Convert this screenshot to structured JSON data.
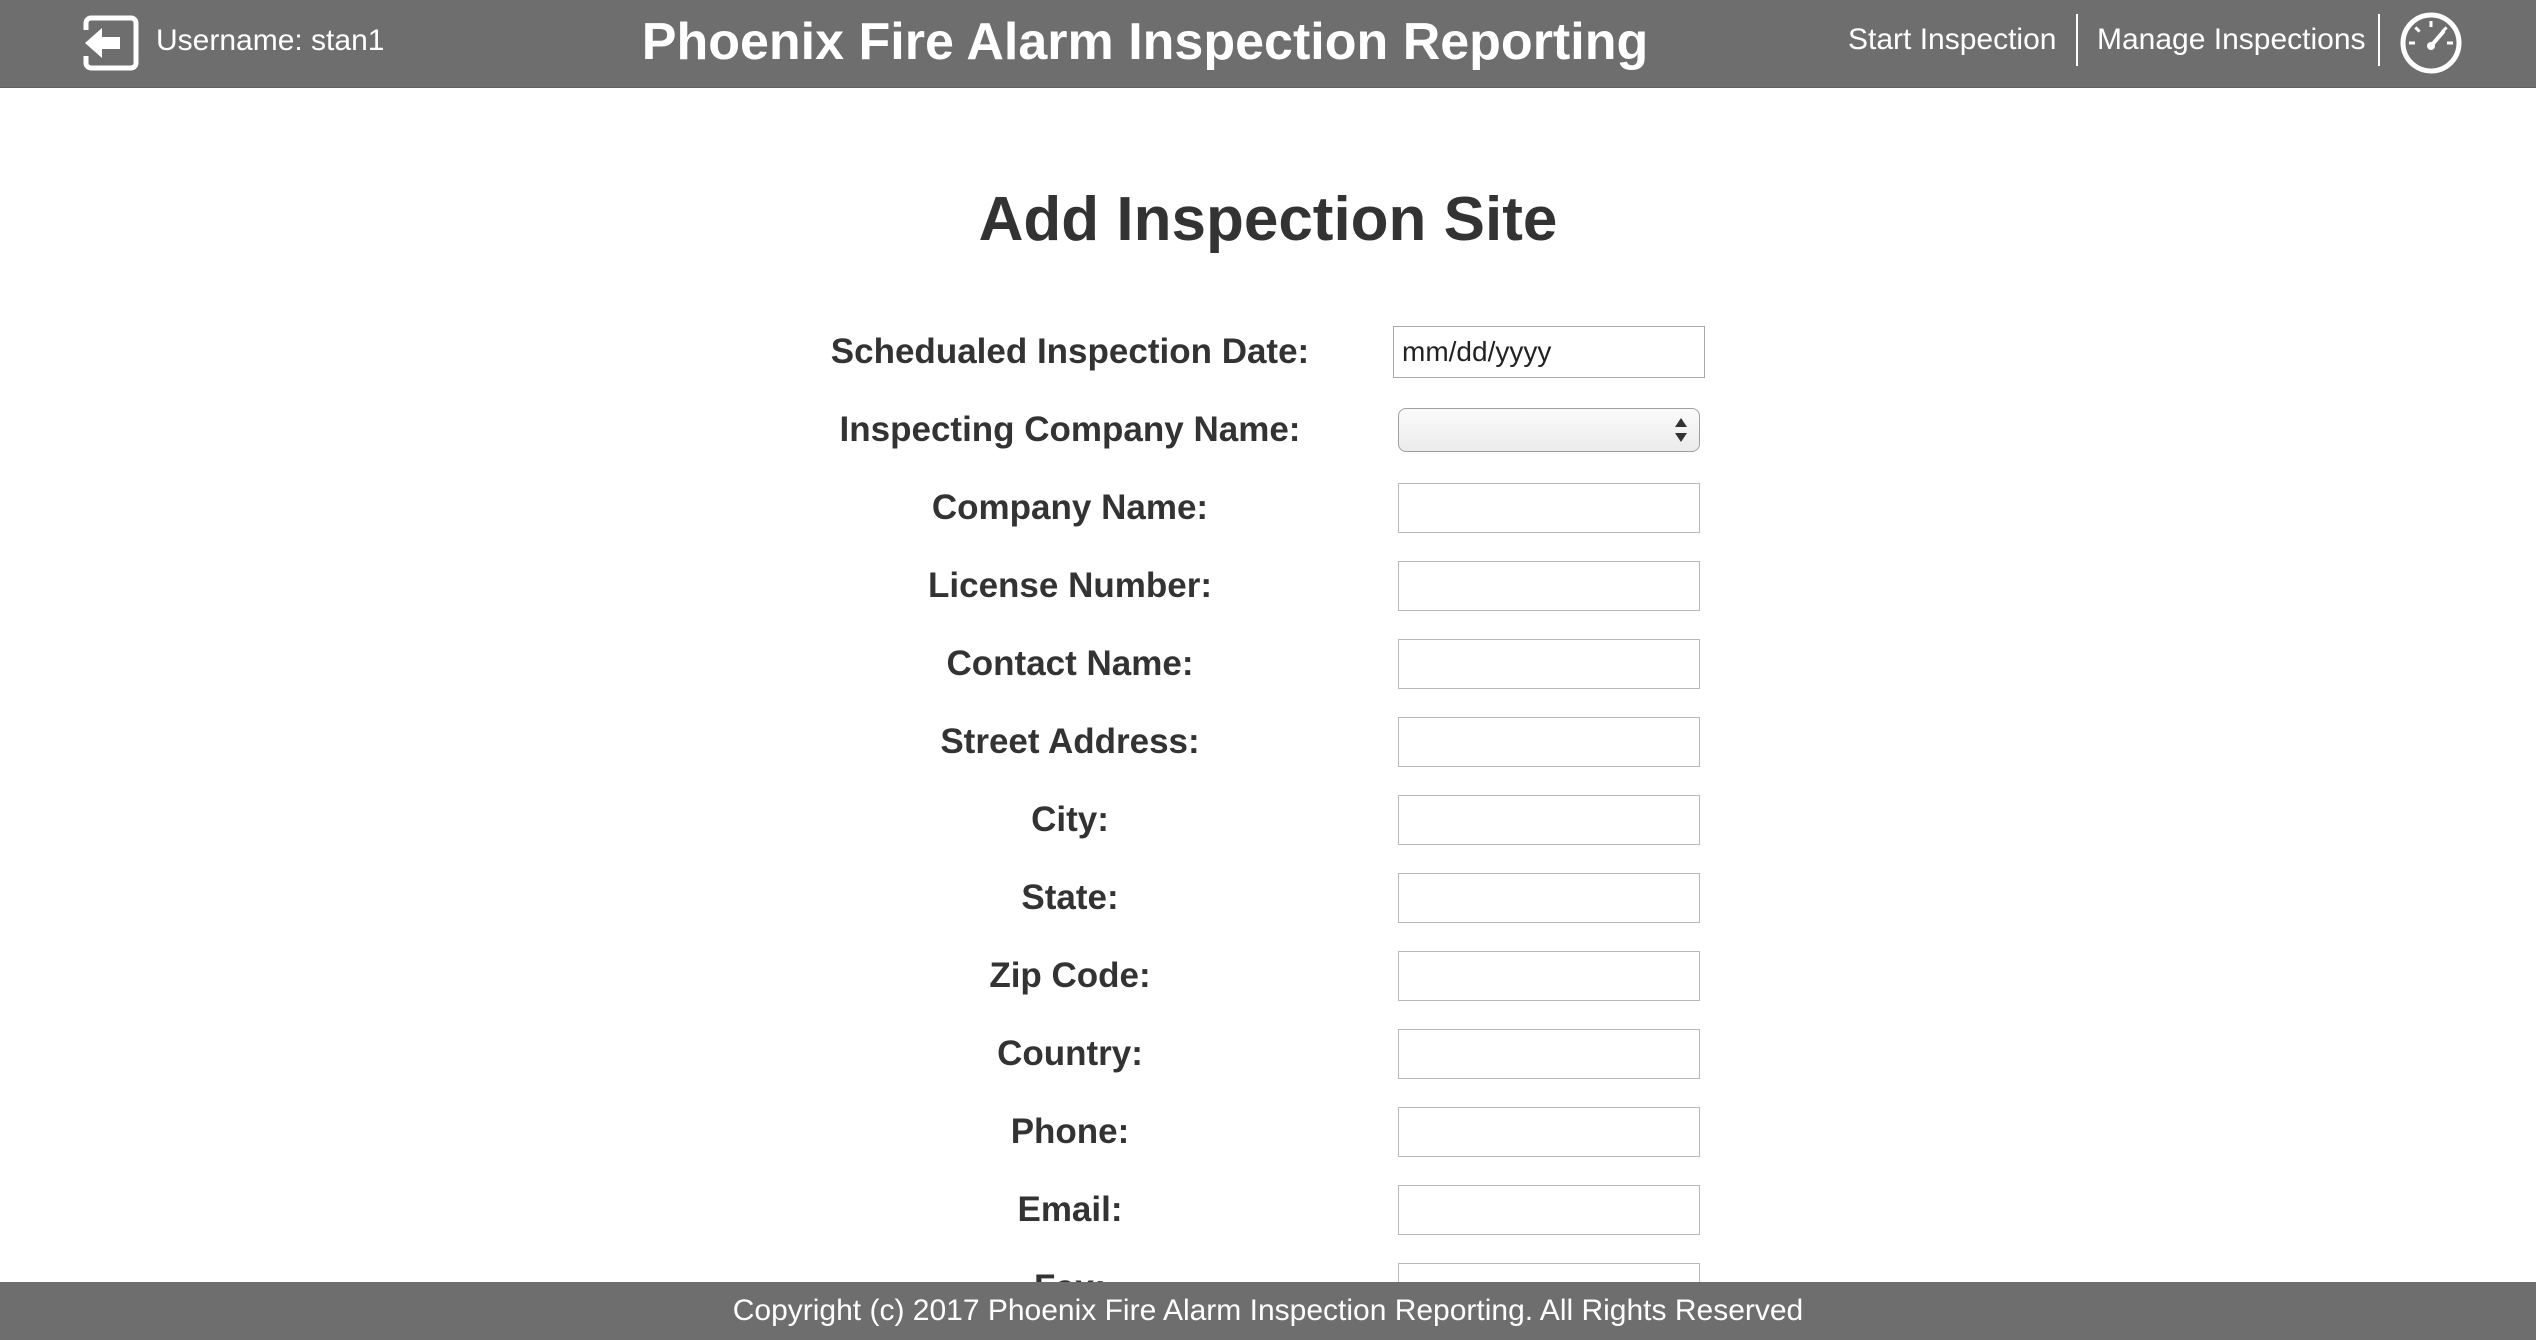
{
  "header": {
    "username_text": "Username: stan1",
    "app_title": "Phoenix Fire Alarm Inspection Reporting",
    "nav": {
      "start_inspection": "Start Inspection",
      "manage_inspections": "Manage Inspections"
    },
    "icons": {
      "logout": "logout-arrow-icon",
      "dashboard": "speedometer-icon"
    }
  },
  "form": {
    "title": "Add Inspection Site",
    "fields": [
      {
        "label": "Schedualed Inspection Date:",
        "type": "date",
        "placeholder": "mm/dd/yyyy",
        "value": ""
      },
      {
        "label": "Inspecting Company Name:",
        "type": "select",
        "value": ""
      },
      {
        "label": "Company Name:",
        "type": "text",
        "value": ""
      },
      {
        "label": "License Number:",
        "type": "text",
        "value": ""
      },
      {
        "label": "Contact Name:",
        "type": "text",
        "value": ""
      },
      {
        "label": "Street Address:",
        "type": "text",
        "value": ""
      },
      {
        "label": "City:",
        "type": "text",
        "value": ""
      },
      {
        "label": "State:",
        "type": "text",
        "value": ""
      },
      {
        "label": "Zip Code:",
        "type": "text",
        "value": ""
      },
      {
        "label": "Country:",
        "type": "text",
        "value": ""
      },
      {
        "label": "Phone:",
        "type": "text",
        "value": ""
      },
      {
        "label": "Email:",
        "type": "text",
        "value": ""
      },
      {
        "label": "Fax:",
        "type": "text",
        "value": ""
      }
    ]
  },
  "footer": {
    "copyright": "Copyright (c) 2017 Phoenix Fire Alarm Inspection Reporting. All Rights Reserved"
  },
  "colors": {
    "bar_background": "#6e6e6e",
    "bar_text": "#ffffff",
    "body_text": "#333333",
    "input_border": "#b8b8b8"
  }
}
